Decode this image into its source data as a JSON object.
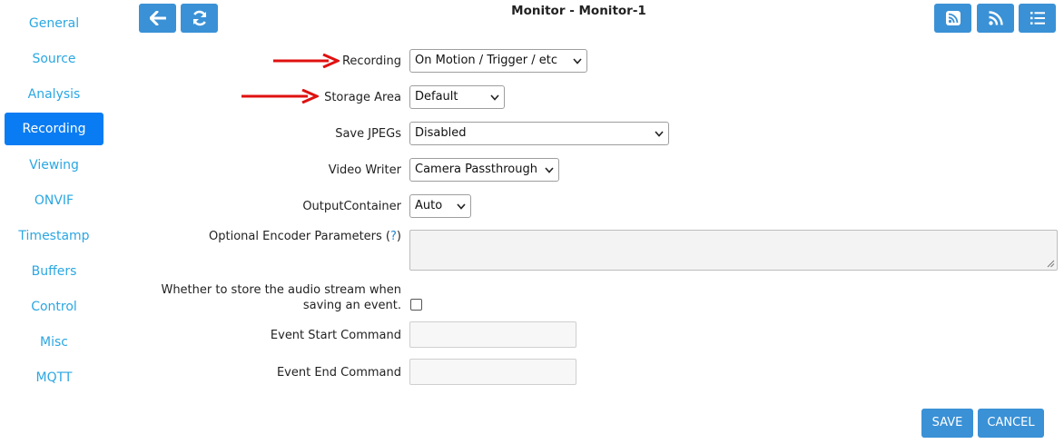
{
  "sidebar": {
    "items": [
      {
        "label": "General"
      },
      {
        "label": "Source"
      },
      {
        "label": "Analysis"
      },
      {
        "label": "Recording"
      },
      {
        "label": "Viewing"
      },
      {
        "label": "ONVIF"
      },
      {
        "label": "Timestamp"
      },
      {
        "label": "Buffers"
      },
      {
        "label": "Control"
      },
      {
        "label": "Misc"
      },
      {
        "label": "MQTT"
      }
    ],
    "active": "Recording"
  },
  "header": {
    "title": "Monitor - Monitor-1",
    "left_buttons": [
      "back-arrow-icon",
      "refresh-icon"
    ],
    "right_buttons": [
      "rss-icon",
      "rss-icon",
      "list-icon"
    ]
  },
  "form": {
    "recording": {
      "label": "Recording",
      "value": "On Motion / Trigger / etc"
    },
    "storage_area": {
      "label": "Storage Area",
      "value": "Default"
    },
    "save_jpegs": {
      "label": "Save JPEGs",
      "value": "Disabled"
    },
    "video_writer": {
      "label": "Video Writer",
      "value": "Camera Passthrough"
    },
    "output_container": {
      "label": "OutputContainer",
      "value": "Auto"
    },
    "encoder_params": {
      "label": "Optional Encoder Parameters (",
      "help": "?",
      "label_end": ")",
      "value": ""
    },
    "audio": {
      "label_line1": "Whether to store the audio stream when",
      "label_line2": "saving an event.",
      "checked": false
    },
    "event_start": {
      "label": "Event Start Command",
      "value": ""
    },
    "event_end": {
      "label": "Event End Command",
      "value": ""
    }
  },
  "footer": {
    "save_label": "SAVE",
    "cancel_label": "CANCEL"
  },
  "colors": {
    "accent": "#3a91d6",
    "active_sidebar": "#0a7cf3",
    "link": "#2ba7e2",
    "annotation_arrow": "#e01010"
  }
}
